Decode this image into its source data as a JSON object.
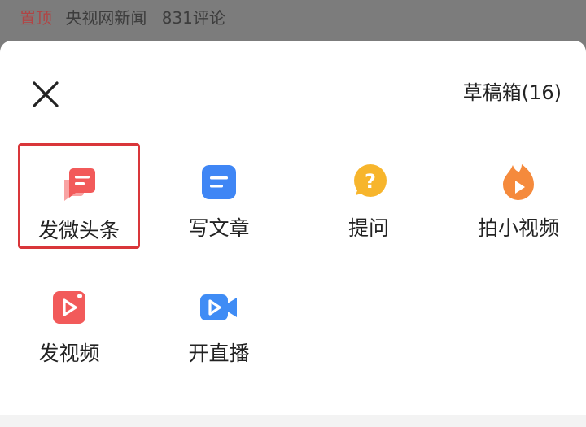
{
  "feed_row": {
    "pin_label": "置顶",
    "source": "央视网新闻",
    "comments": "831评论"
  },
  "sheet": {
    "close_icon": "close-icon",
    "drafts_label": "草稿箱(16)",
    "actions": [
      {
        "id": "post-weitoutiao",
        "label": "发微头条",
        "icon": "chat-bubble-icon",
        "color": "#f25a5a",
        "highlighted": true
      },
      {
        "id": "write-article",
        "label": "写文章",
        "icon": "document-icon",
        "color": "#3f86f5",
        "highlighted": false
      },
      {
        "id": "ask-question",
        "label": "提问",
        "icon": "question-bubble-icon",
        "color": "#f7b52c",
        "highlighted": false
      },
      {
        "id": "shoot-short-video",
        "label": "拍小视频",
        "icon": "flame-play-icon",
        "color": "#f58a3c",
        "highlighted": false
      },
      {
        "id": "post-video",
        "label": "发视频",
        "icon": "video-play-icon",
        "color": "#f25a5a",
        "highlighted": false
      },
      {
        "id": "start-live",
        "label": "开直播",
        "icon": "video-camera-icon",
        "color": "#3f8cf5",
        "highlighted": false
      }
    ]
  }
}
